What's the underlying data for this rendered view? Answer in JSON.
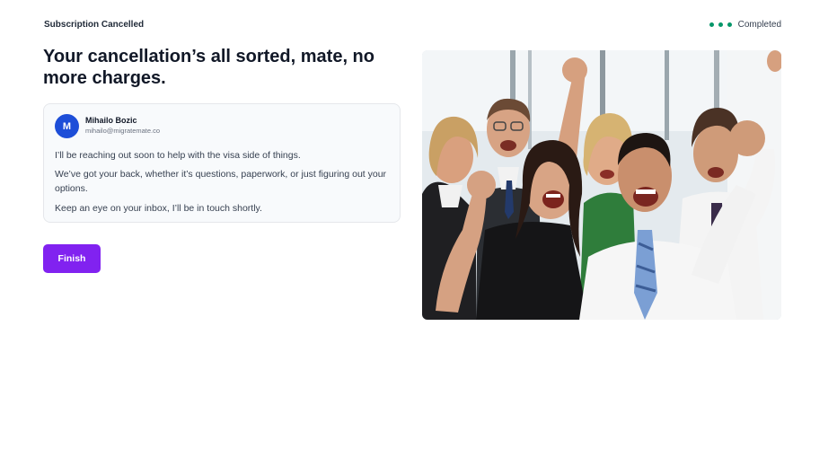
{
  "header": {
    "title": "Subscription Cancelled",
    "status_label": "Completed",
    "steps_completed": 3,
    "step_color": "#059669"
  },
  "main": {
    "headline": "Your cancellation’s all sorted, mate, no more charges."
  },
  "message_card": {
    "sender": {
      "initial": "M",
      "name": "Mihailo Bozic",
      "email": "mihailo@migratemate.co"
    },
    "paragraphs": [
      "I’ll be reaching out soon to help with the visa side of things.",
      "We’ve got your back, whether it’s questions, paperwork, or just figuring out your options.",
      "Keep an eye on your inbox, I’ll be in touch shortly."
    ]
  },
  "actions": {
    "finish_label": "Finish",
    "accent_color": "#8122f0"
  },
  "image": {
    "subject": "celebrating-business-team-photo"
  }
}
